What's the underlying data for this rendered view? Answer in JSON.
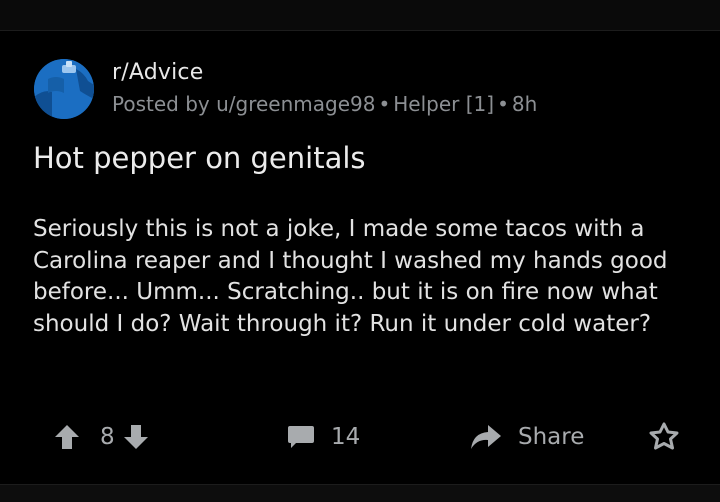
{
  "post": {
    "subreddit": "r/Advice",
    "meta": {
      "posted_by": "Posted by u/greenmage98",
      "flair": "Helper [1]",
      "age": "8h"
    },
    "title": "Hot pepper on genitals",
    "body": "Seriously this is not a joke, I made some tacos with a Carolina reaper and I thought I washed my hands good before... Umm... Scratching.. but it is on fire now what should I do? Wait through it? Run it under cold water?",
    "votes": "8",
    "comments": "14",
    "share_label": "Share"
  },
  "icons": {
    "upvote": "arrow-up-icon",
    "downvote": "arrow-down-icon",
    "comments": "comment-icon",
    "share": "share-icon",
    "award": "award-icon"
  },
  "colors": {
    "background": "#000000",
    "text_primary": "#d7dadc",
    "text_meta": "#8c8f93",
    "avatar_blue": "#1b6ec2"
  }
}
